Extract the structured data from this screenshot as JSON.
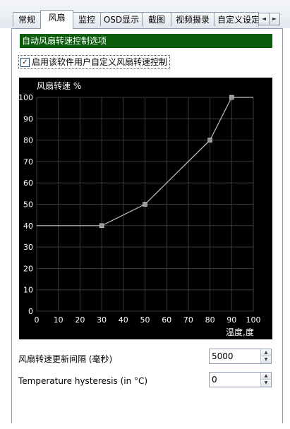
{
  "tabs": [
    {
      "label": "常规"
    },
    {
      "label": "风扇"
    },
    {
      "label": "监控"
    },
    {
      "label": "OSD显示"
    },
    {
      "label": "截图"
    },
    {
      "label": "视频摄录"
    },
    {
      "label": "自定义设定"
    }
  ],
  "tab_scroll": {
    "left": "◄",
    "right": "►"
  },
  "section_header": "自动风扇转速控制选项",
  "enable_checkbox": {
    "label": "启用该软件用户自定义风扇转速控制",
    "checked": true,
    "mark": "✓"
  },
  "chart_data": {
    "type": "line",
    "ylabel": "风扇转速 %",
    "xlabel": "温度,度",
    "xlim": [
      0,
      100
    ],
    "ylim": [
      0,
      100
    ],
    "x_ticks": [
      "0",
      "10",
      "20",
      "30",
      "40",
      "50",
      "60",
      "70",
      "80",
      "90",
      "100"
    ],
    "y_ticks": [
      "0",
      "10",
      "20",
      "30",
      "40",
      "50",
      "60",
      "70",
      "80",
      "90",
      "100"
    ],
    "grid": true,
    "series": [
      {
        "x": [
          0,
          30,
          50,
          80,
          90,
          100
        ],
        "y": [
          40,
          40,
          50,
          80,
          100,
          100
        ],
        "control_points": [
          [
            30,
            40
          ],
          [
            50,
            50
          ],
          [
            80,
            80
          ],
          [
            90,
            100
          ]
        ]
      }
    ],
    "colors": {
      "background": "#000000",
      "line": "#bfbfbf",
      "grid": "#3a3a3a",
      "text": "#ffffff",
      "point": "#9a9a9a"
    }
  },
  "update_interval": {
    "label": "风扇转速更新间隔 (毫秒)",
    "value": "5000"
  },
  "hysteresis": {
    "label": "Temperature hysteresis (in °C)",
    "value": "0"
  },
  "spin_arrows": {
    "up": "▲",
    "down": "▼"
  }
}
